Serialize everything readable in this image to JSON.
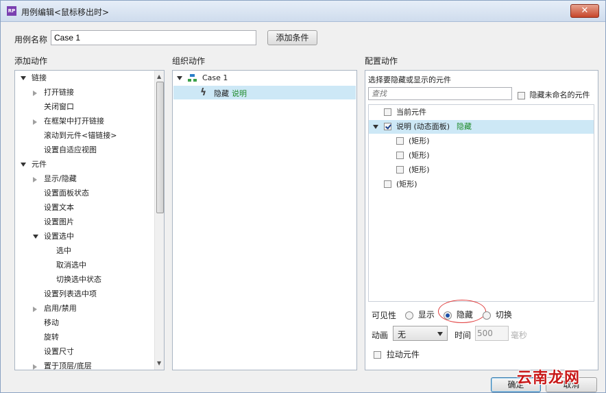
{
  "window": {
    "title": "用例编辑<鼠标移出时>",
    "app_icon_text": "RP",
    "close": "✕"
  },
  "case_name": {
    "label": "用例名称",
    "value": "Case 1",
    "add_condition": "添加条件"
  },
  "add_actions": {
    "header": "添加动作",
    "items": [
      {
        "label": "链接",
        "depth": 0,
        "expander": "open"
      },
      {
        "label": "打开链接",
        "depth": 1,
        "expander": "closed"
      },
      {
        "label": "关闭窗口",
        "depth": 1,
        "expander": "none"
      },
      {
        "label": "在框架中打开链接",
        "depth": 1,
        "expander": "closed"
      },
      {
        "label": "滚动到元件<锚链接>",
        "depth": 1,
        "expander": "none"
      },
      {
        "label": "设置自适应视图",
        "depth": 1,
        "expander": "none"
      },
      {
        "label": "元件",
        "depth": 0,
        "expander": "open"
      },
      {
        "label": "显示/隐藏",
        "depth": 1,
        "expander": "closed"
      },
      {
        "label": "设置面板状态",
        "depth": 1,
        "expander": "none"
      },
      {
        "label": "设置文本",
        "depth": 1,
        "expander": "none"
      },
      {
        "label": "设置图片",
        "depth": 1,
        "expander": "none"
      },
      {
        "label": "设置选中",
        "depth": 1,
        "expander": "open"
      },
      {
        "label": "选中",
        "depth": 2,
        "expander": "none"
      },
      {
        "label": "取消选中",
        "depth": 2,
        "expander": "none"
      },
      {
        "label": "切换选中状态",
        "depth": 2,
        "expander": "none"
      },
      {
        "label": "设置列表选中项",
        "depth": 1,
        "expander": "none"
      },
      {
        "label": "启用/禁用",
        "depth": 1,
        "expander": "closed"
      },
      {
        "label": "移动",
        "depth": 1,
        "expander": "none"
      },
      {
        "label": "旋转",
        "depth": 1,
        "expander": "none"
      },
      {
        "label": "设置尺寸",
        "depth": 1,
        "expander": "none"
      },
      {
        "label": "置于顶层/底层",
        "depth": 1,
        "expander": "closed"
      }
    ]
  },
  "organize_actions": {
    "header": "组织动作",
    "case_label": "Case 1",
    "action_verb": "隐藏",
    "action_target": "说明"
  },
  "configure_actions": {
    "header": "配置动作",
    "subheader": "选择要隐藏或显示的元件",
    "search_placeholder": "查找",
    "hide_unnamed": "隐藏未命名的元件",
    "widgets": [
      {
        "label": "当前元件",
        "status": "",
        "checked": false,
        "depth": 0,
        "expander": false
      },
      {
        "label": "说明 (动态面板)",
        "status": "隐藏",
        "checked": true,
        "depth": 0,
        "expander": true
      },
      {
        "label": "(矩形)",
        "status": "",
        "checked": false,
        "depth": 1,
        "expander": false
      },
      {
        "label": "(矩形)",
        "status": "",
        "checked": false,
        "depth": 1,
        "expander": false
      },
      {
        "label": "(矩形)",
        "status": "",
        "checked": false,
        "depth": 1,
        "expander": false
      },
      {
        "label": "(矩形)",
        "status": "",
        "checked": false,
        "depth": 0,
        "expander": false
      }
    ],
    "visibility_label": "可见性",
    "visibility_options": [
      "显示",
      "隐藏",
      "切换"
    ],
    "visibility_selected": "隐藏",
    "animation_label": "动画",
    "animation_value": "无",
    "time_label": "时间",
    "time_value": "500",
    "time_unit": "毫秒",
    "drag_widget": "拉动元件"
  },
  "buttons": {
    "ok": "确定",
    "cancel": "取消"
  },
  "watermark": "云南龙网"
}
